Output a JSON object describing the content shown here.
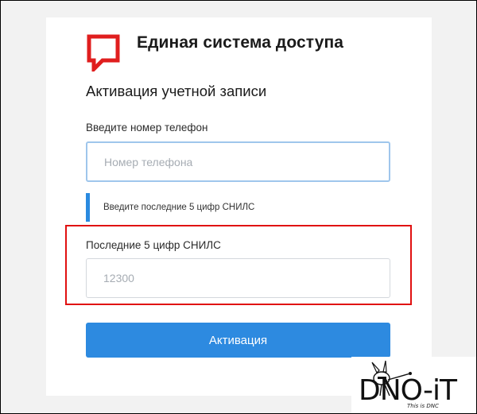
{
  "brand": {
    "title": "Единая система доступа",
    "logo_color": "#e01e1e"
  },
  "page": {
    "title": "Активация учетной записи"
  },
  "phone": {
    "label": "Введите номер телефон",
    "placeholder": "Номер телефона",
    "value": ""
  },
  "hint": {
    "text": "Введите последние 5 цифр СНИЛС",
    "accent": "#2a8ae0"
  },
  "snils": {
    "label": "Последние 5 цифр СНИЛС",
    "placeholder": "12300",
    "value": ""
  },
  "action": {
    "label": "Активация",
    "color": "#2d8ae0"
  },
  "highlight_color": "#e01010",
  "watermark": {
    "text": "DNO-iT",
    "subtitle": "This is DNC"
  }
}
